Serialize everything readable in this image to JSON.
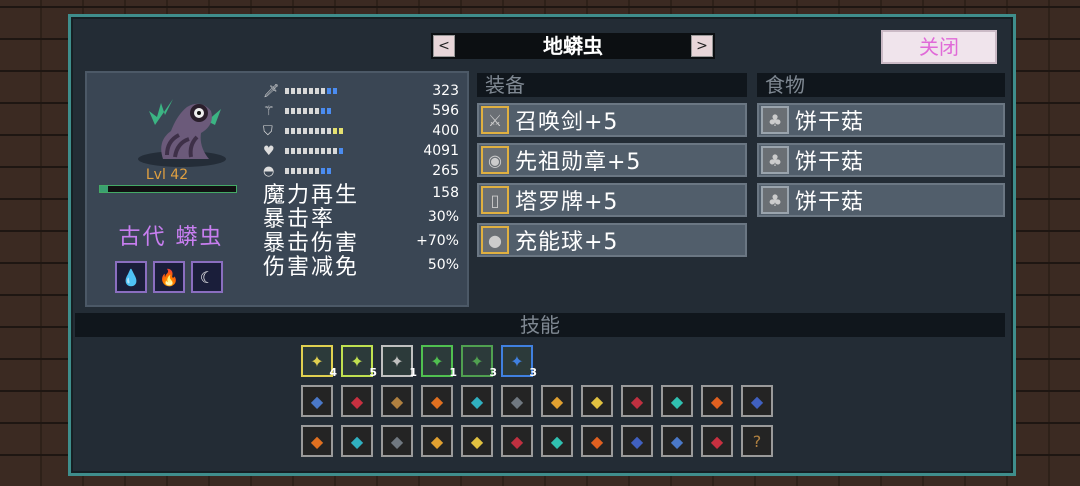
{
  "header": {
    "title": "地蟒虫",
    "prev_label": "<",
    "next_label": ">",
    "close_label": "关闭"
  },
  "character": {
    "level": "Lvl 42",
    "name": "古代 蟒虫",
    "buff_icons": [
      "water-fire-buff-icon",
      "flame-shield-buff-icon",
      "moon-buff-icon"
    ],
    "stats": [
      {
        "icon": "sword-stat-icon",
        "value": "323",
        "bar": [
          "w",
          "w",
          "w",
          "w",
          "w",
          "w",
          "w",
          "b",
          "b"
        ]
      },
      {
        "icon": "wand-stat-icon",
        "value": "596",
        "bar": [
          "w",
          "w",
          "w",
          "w",
          "w",
          "w",
          "b",
          "b"
        ]
      },
      {
        "icon": "shield-stat-icon",
        "value": "400",
        "bar": [
          "w",
          "w",
          "w",
          "w",
          "w",
          "w",
          "w",
          "w",
          "y",
          "y"
        ]
      },
      {
        "icon": "heart-stat-icon",
        "value": "4091",
        "bar": [
          "w",
          "w",
          "w",
          "w",
          "w",
          "w",
          "w",
          "w",
          "w",
          "b"
        ]
      },
      {
        "icon": "speed-stat-icon",
        "value": "265",
        "bar": [
          "w",
          "w",
          "w",
          "w",
          "w",
          "w",
          "b",
          "b"
        ]
      }
    ],
    "derived": [
      {
        "label": "魔力再生",
        "value": "158"
      },
      {
        "label": "暴击率",
        "value": "30%"
      },
      {
        "label": "暴击伤害",
        "value": "+70%"
      },
      {
        "label": "伤害减免",
        "value": "50%"
      }
    ]
  },
  "equipment": {
    "header": "装备",
    "items": [
      {
        "icon": "sword-icon",
        "label": "召唤剑+5"
      },
      {
        "icon": "medal-icon",
        "label": "先祖勋章+5"
      },
      {
        "icon": "tarot-card-icon",
        "label": "塔罗牌+5"
      },
      {
        "icon": "orb-icon",
        "label": "充能球+5"
      }
    ]
  },
  "food": {
    "header": "食物",
    "items": [
      {
        "icon": "mushroom-icon",
        "label": "饼干菇"
      },
      {
        "icon": "mushroom-icon",
        "label": "饼干菇"
      },
      {
        "icon": "mushroom-icon",
        "label": "饼干菇"
      }
    ]
  },
  "skills": {
    "header": "技能",
    "row1": [
      {
        "icon": "claw-skill-icon",
        "level": "4",
        "color": "#e0d050"
      },
      {
        "icon": "wind-skill-icon",
        "level": "5",
        "color": "#c0e050"
      },
      {
        "icon": "shield-wind-skill-icon",
        "level": "1",
        "color": "#c0c0c0"
      },
      {
        "icon": "green-orb-skill-icon",
        "level": "1",
        "color": "#50c050"
      },
      {
        "icon": "spore-skill-icon",
        "level": "3",
        "color": "#50a050"
      },
      {
        "icon": "shield-sword-skill-icon",
        "level": "3",
        "color": "#4080e0"
      }
    ],
    "row2": [
      "hand-skill-icon",
      "blood-skill-icon",
      "wave-skill-icon",
      "coin-skill-icon",
      "snowflake-skill-icon",
      "stone-skill-icon",
      "armor-skill-icon",
      "sun-skill-icon",
      "rune-skill-icon",
      "link-skill-icon",
      "orb-link-skill-icon",
      "crack-shield-skill-icon"
    ],
    "row3": [
      "lightning-skill-icon",
      "drop-skill-icon",
      "cycle-skill-icon",
      "sword-cross-skill-icon",
      "slash-skill-icon",
      "rise-skill-icon",
      "rain-skill-icon",
      "chain-skill-icon",
      "swirl-skill-icon",
      "potion-skill-icon",
      "ring-skill-icon",
      "unknown-skill-icon"
    ]
  }
}
